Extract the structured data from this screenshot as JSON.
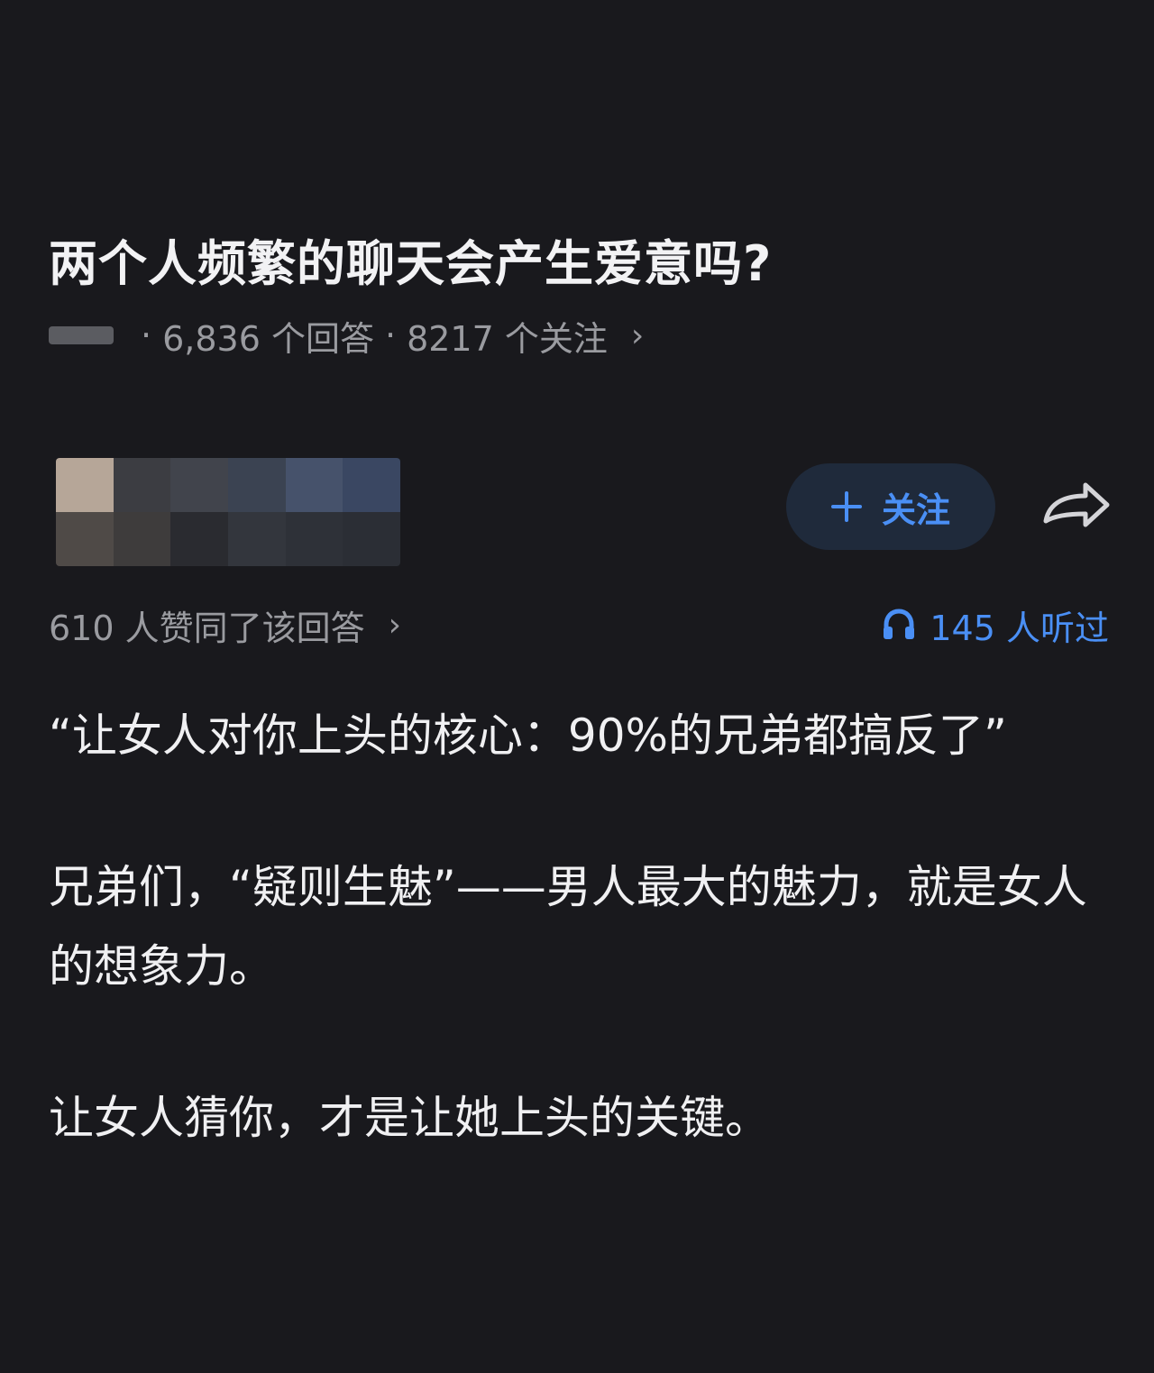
{
  "question": {
    "title": "两个人频繁的聊天会产生爱意吗?",
    "answers_count": "6,836 个回答",
    "followers_count": "8217 个关注"
  },
  "answer_header": {
    "follow_label": "关注"
  },
  "answer_stats": {
    "upvote_text": "610 人赞同了该回答",
    "listen_text": "145 人听过"
  },
  "answer_paragraphs": [
    "“让女人对你上头的核心：90%的兄弟都搞反了”",
    "兄弟们，“疑则生魅”——男人最大的魅力，就是女人的想象力。",
    "让女人猜你，才是让她上头的关键。"
  ],
  "icons": {
    "follow": "plus-icon",
    "share": "share-arrow-icon",
    "listen": "headphone-icon",
    "more": "chevron-right-icon"
  },
  "colors": {
    "background": "#19191d",
    "accent": "#4a8ff5",
    "muted_text": "#9a9ba0",
    "primary_text": "#f0f0f2"
  }
}
